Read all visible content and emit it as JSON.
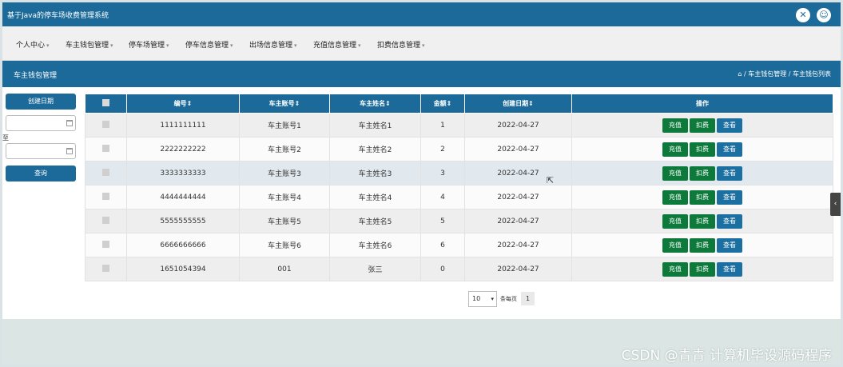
{
  "app": {
    "title": "基于Java的停车场收费管理系统"
  },
  "nav": {
    "items": [
      "个人中心",
      "车主钱包管理",
      "停车场管理",
      "停车信息管理",
      "出场信息管理",
      "充值信息管理",
      "扣费信息管理"
    ]
  },
  "page": {
    "title": "车主钱包管理",
    "breadcrumb": "⌂ / 车主钱包管理 / 车主钱包列表"
  },
  "filter": {
    "date_label": "创建日期",
    "to_label": "至",
    "search_label": "查询",
    "start_value": "",
    "end_value": ""
  },
  "table": {
    "headers": [
      "",
      "编号⇕",
      "车主账号⇕",
      "车主姓名⇕",
      "金额⇕",
      "创建日期⇕",
      "操作"
    ],
    "rows": [
      [
        "1111111111",
        "车主账号1",
        "车主姓名1",
        "1",
        "2022-04-27"
      ],
      [
        "2222222222",
        "车主账号2",
        "车主姓名2",
        "2",
        "2022-04-27"
      ],
      [
        "3333333333",
        "车主账号3",
        "车主姓名3",
        "3",
        "2022-04-27"
      ],
      [
        "4444444444",
        "车主账号4",
        "车主姓名4",
        "4",
        "2022-04-27"
      ],
      [
        "5555555555",
        "车主账号5",
        "车主姓名5",
        "5",
        "2022-04-27"
      ],
      [
        "6666666666",
        "车主账号6",
        "车主姓名6",
        "6",
        "2022-04-27"
      ],
      [
        "1651054394",
        "001",
        "张三",
        "0",
        "2022-04-27"
      ]
    ],
    "actions": [
      "充值",
      "扣费",
      "查看"
    ]
  },
  "pager": {
    "page_size": "10",
    "per_page_label": "条每页",
    "current_page": "1"
  },
  "watermark": "CSDN @青青 计算机毕设源码程序",
  "colors": {
    "primary": "#1b6a99",
    "green": "#0d7a3c",
    "blue": "#1c6fa1"
  }
}
